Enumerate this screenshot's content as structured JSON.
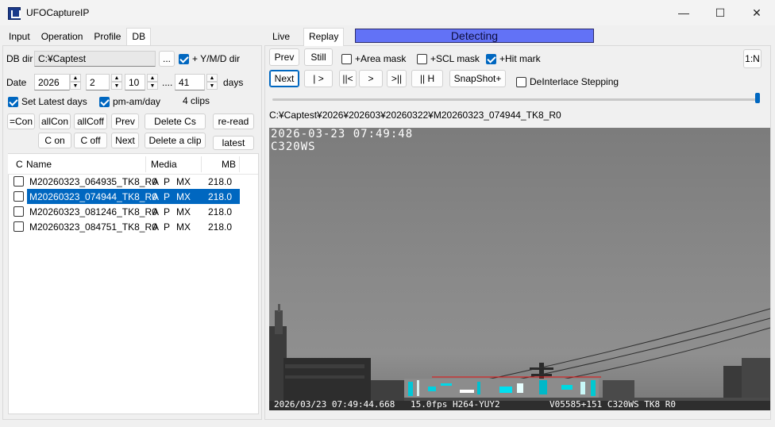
{
  "window": {
    "title": "UFOCaptureIP",
    "minimize": "—",
    "maximize": "☐",
    "close": "✕"
  },
  "left_tabs": [
    "Input",
    "Operation",
    "Profile",
    "DB"
  ],
  "db": {
    "dir_label": "DB dir",
    "dir_value": "C:¥Captest",
    "browse": "...",
    "ymd_label": "+ Y/M/D dir",
    "date_label": "Date",
    "year": "2026",
    "month": "2",
    "day": "10",
    "ellipsis": "....",
    "days_value": "41",
    "days_label": "days",
    "set_latest": "Set Latest days",
    "pm_am": "pm-am/day",
    "clips_count": "4 clips",
    "buttons_row1": [
      "=Con",
      "allCon",
      "allCoff",
      "Prev",
      "Delete Cs",
      "re-read"
    ],
    "buttons_row2": [
      "C on",
      "C off",
      "Next",
      "Delete a clip",
      "latest"
    ]
  },
  "list": {
    "headers": [
      "C",
      "Name",
      "Media",
      "MB"
    ],
    "rows": [
      {
        "name": "M20260323_064935_TK8_R0",
        "a": "A",
        "p": "P",
        "mx": "MX",
        "mb": "218.0"
      },
      {
        "name": "M20260323_074944_TK8_R0",
        "a": "A",
        "p": "P",
        "mx": "MX",
        "mb": "218.0"
      },
      {
        "name": "M20260323_081246_TK8_R0",
        "a": "A",
        "p": "P",
        "mx": "MX",
        "mb": "218.0"
      },
      {
        "name": "M20260323_084751_TK8_R0",
        "a": "A",
        "p": "P",
        "mx": "MX",
        "mb": "218.0"
      }
    ]
  },
  "right_tabs": [
    "Live",
    "Replay"
  ],
  "status": {
    "text": "Detecting",
    "color": "#6272f6"
  },
  "replay": {
    "prev": "Prev",
    "still": "Still",
    "area_mask": "+Area mask",
    "scl_mask": "+SCL mask",
    "hit_mark": "+Hit mark",
    "ratio": "1:N",
    "next": "Next",
    "play": "| >",
    "first": "||<",
    "step": ">",
    "last": ">||",
    "half": "|| H",
    "snapshot": "SnapShot+",
    "deinterlace": "DeInterlace Stepping",
    "slider_position": 1.0,
    "path": "C:¥Captest¥2026¥202603¥20260322¥M20260323_074944_TK8_R0"
  },
  "video": {
    "timestamp_top": "2026-03-23 07:49:48",
    "camera_top": "C320WS",
    "bottom_time": "2026/03/23 07:49:44.668",
    "bottom_fps": "15.0fps H264-YUY2",
    "bottom_info": "V05585+151 C320WS TK8 R0"
  }
}
